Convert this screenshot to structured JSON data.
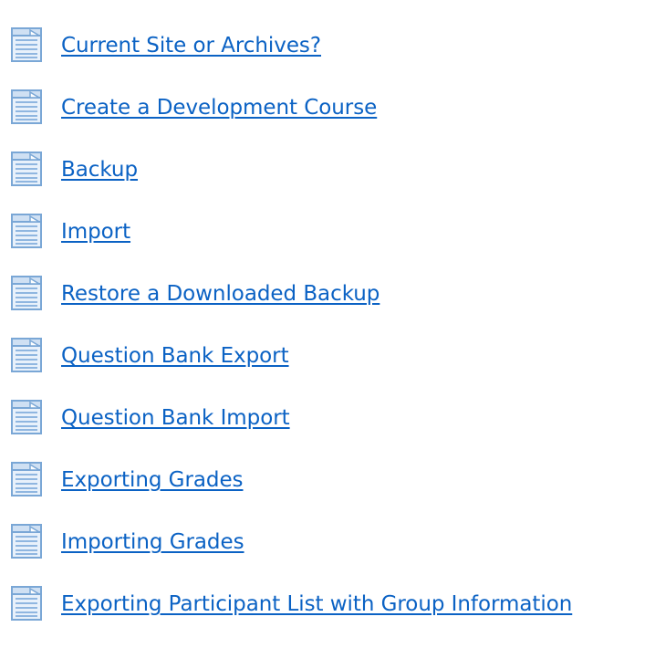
{
  "icon": "document-page-icon",
  "colors": {
    "link": "#0b62c4",
    "icon_page": "#e8f1fb",
    "icon_border": "#7aa7d6",
    "icon_lines": "#8fb6e0"
  },
  "links": [
    {
      "label": "Current Site or Archives?"
    },
    {
      "label": "Create a Development Course"
    },
    {
      "label": "Backup"
    },
    {
      "label": "Import"
    },
    {
      "label": "Restore a Downloaded Backup"
    },
    {
      "label": "Question Bank Export"
    },
    {
      "label": "Question Bank Import"
    },
    {
      "label": "Exporting Grades"
    },
    {
      "label": "Importing Grades"
    },
    {
      "label": "Exporting Participant List with Group Information"
    }
  ]
}
